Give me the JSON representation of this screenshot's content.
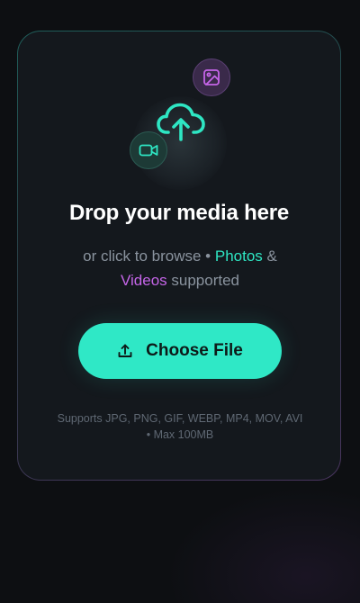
{
  "dropzone": {
    "title": "Drop your media here",
    "subtitle_prefix": "or click to browse • ",
    "subtitle_photos": "Photos",
    "subtitle_and": " &",
    "subtitle_videos": "Videos",
    "subtitle_suffix": " supported",
    "button_label": "Choose File",
    "footnote_line1": "Supports JPG, PNG, GIF, WEBP, MP4, MOV, AVI",
    "footnote_line2": "• Max 100MB",
    "icons": {
      "main": "cloud-upload-icon",
      "photo_badge": "image-icon",
      "video_badge": "video-camera-icon",
      "button": "upload-icon"
    }
  },
  "colors": {
    "background": "#0d0f12",
    "card": "#14181d",
    "accent_teal": "#2fe8c6",
    "accent_purple": "#c565e8",
    "muted_text": "#8a939e"
  }
}
